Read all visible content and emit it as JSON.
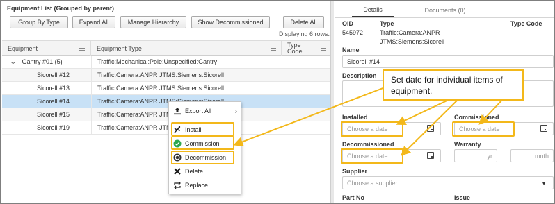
{
  "list": {
    "title": "Equipment List (Grouped by parent)",
    "buttons": [
      "Group By Type",
      "Expand All",
      "Manage Hierarchy",
      "Show Decommissioned",
      "Delete All"
    ],
    "row_count_text": "Displaying 6 rows.",
    "columns": [
      "Equipment",
      "Equipment Type",
      "Type Code"
    ],
    "group": {
      "toggle_icon": "chevron-down-icon",
      "label": "Gantry #01  (5)",
      "type": "Traffic:Mechanical:Pole:Unspecified:Gantry"
    },
    "rows": [
      {
        "name": "Sicorell #12",
        "type": "Traffic:Camera:ANPR JTMS:Siemens:Sicorell"
      },
      {
        "name": "Sicorell #13",
        "type": "Traffic:Camera:ANPR JTMS:Siemens:Sicorell"
      },
      {
        "name": "Sicorell #14",
        "type": "Traffic:Camera:ANPR JTMS:Siemens:Sicorell"
      },
      {
        "name": "Sicorell #15",
        "type": "Traffic:Camera:ANPR JTMS:Siemens:Sicorell"
      },
      {
        "name": "Sicorell #19",
        "type": "Traffic:Camera:ANPR JTMS:Siemens:Sicorell"
      }
    ]
  },
  "context_menu": {
    "items": [
      {
        "label": "Export All",
        "icon": "export-icon"
      },
      {
        "label": "Install",
        "icon": "install-icon"
      },
      {
        "label": "Commission",
        "icon": "check-circle-icon"
      },
      {
        "label": "Decommission",
        "icon": "stop-circle-icon"
      },
      {
        "label": "Delete",
        "icon": "x-icon"
      },
      {
        "label": "Replace",
        "icon": "replace-icon"
      }
    ],
    "highlight_color": "#f3b81a"
  },
  "details": {
    "tabs": [
      "Details",
      "Documents (0)"
    ],
    "oid_label": "OID",
    "oid_value": "545972",
    "type_label": "Type",
    "type_value_line1": "Traffic:Camera:ANPR",
    "type_value_line2": "JTMS:Siemens:Sicorell",
    "type_code_label": "Type Code",
    "name_label": "Name",
    "name_value": "Sicorell #14",
    "description_label": "Description",
    "installed_label": "Installed",
    "installed_placeholder": "Choose a date",
    "commissioned_label": "Commissioned",
    "commissioned_placeholder": "Choose a date",
    "decommissioned_label": "Decommissioned",
    "decommissioned_placeholder": "Choose a date",
    "warranty_label": "Warranty",
    "warranty_yr": "yr",
    "warranty_mnth": "mnth",
    "supplier_label": "Supplier",
    "supplier_placeholder": "Choose a supplier",
    "part_no_label": "Part No",
    "issue_label": "Issue"
  },
  "annotation": {
    "text": "Set date for individual items of equipment.",
    "color": "#f3b81a"
  }
}
